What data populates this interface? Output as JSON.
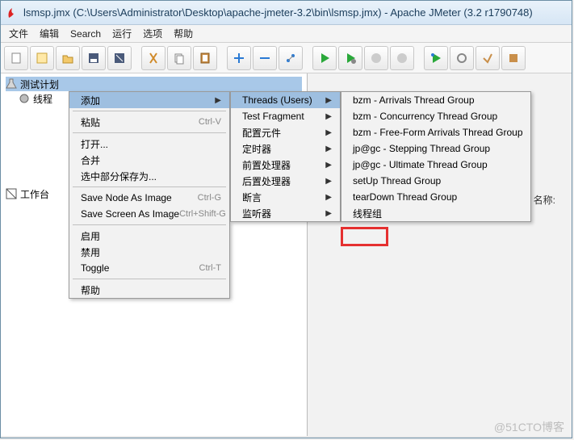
{
  "window": {
    "title": "lsmsp.jmx (C:\\Users\\Administrator\\Desktop\\apache-jmeter-3.2\\bin\\lsmsp.jmx) - Apache JMeter (3.2 r1790748)"
  },
  "menubar": [
    "文件",
    "编辑",
    "Search",
    "运行",
    "选项",
    "帮助"
  ],
  "tree": {
    "root": "测试计划",
    "child": "线程",
    "workbench": "工作台"
  },
  "rightpane": {
    "name_label": "名称:"
  },
  "context_menu": {
    "add": "添加",
    "paste": "粘贴",
    "paste_sc": "Ctrl-V",
    "open": "打开...",
    "merge": "合并",
    "save_sel": "选中部分保存为...",
    "save_node": "Save Node As Image",
    "save_node_sc": "Ctrl-G",
    "save_screen": "Save Screen As Image",
    "save_screen_sc": "Ctrl+Shift-G",
    "enable": "启用",
    "disable": "禁用",
    "toggle": "Toggle",
    "toggle_sc": "Ctrl-T",
    "help": "帮助"
  },
  "submenu1": {
    "threads": "Threads (Users)",
    "fragment": "Test Fragment",
    "config": "配置元件",
    "timer": "定时器",
    "pre": "前置处理器",
    "post": "后置处理器",
    "assert": "断言",
    "listener": "监听器"
  },
  "submenu2": {
    "i0": "bzm - Arrivals Thread Group",
    "i1": "bzm - Concurrency Thread Group",
    "i2": "bzm - Free-Form Arrivals Thread Group",
    "i3": "jp@gc - Stepping Thread Group",
    "i4": "jp@gc - Ultimate Thread Group",
    "i5": "setUp Thread Group",
    "i6": "tearDown Thread Group",
    "i7": "线程组"
  },
  "watermark": "@51CTO博客"
}
